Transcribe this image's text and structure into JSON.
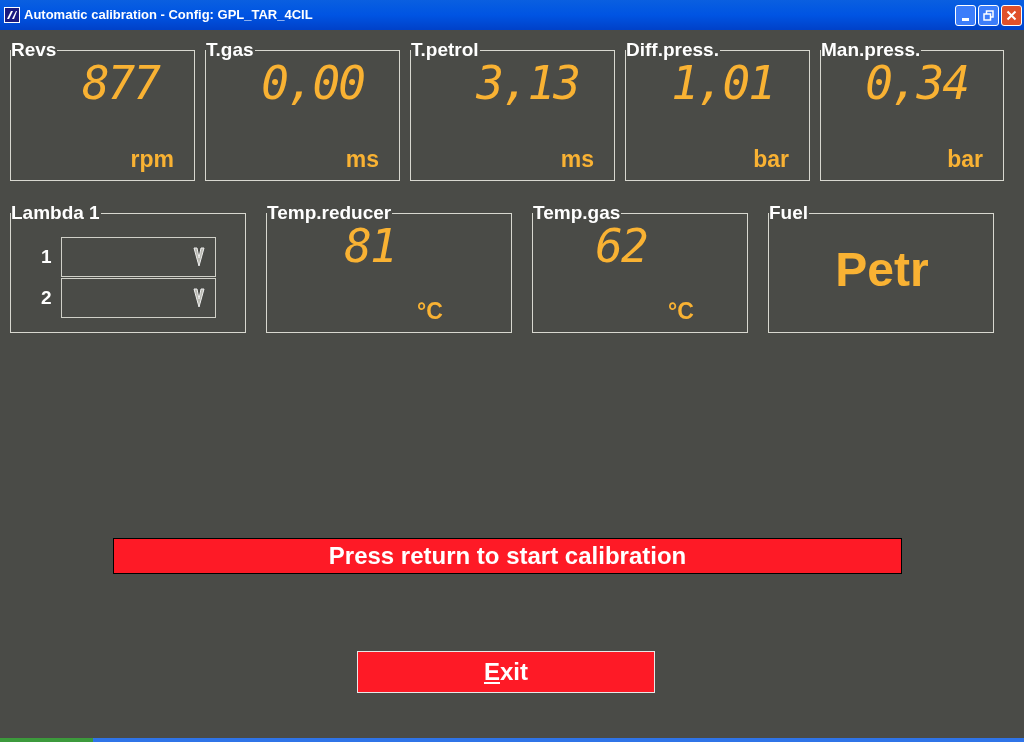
{
  "window": {
    "title": "Automatic calibration - Config: GPL_TAR_4CIL"
  },
  "gauges_top": [
    {
      "label": "Revs",
      "value": "877",
      "unit": "rpm"
    },
    {
      "label": "T.gas",
      "value": "0,00",
      "unit": "ms"
    },
    {
      "label": "T.petrol",
      "value": "3,13",
      "unit": "ms"
    },
    {
      "label": "Diff.press.",
      "value": "1,01",
      "unit": "bar"
    },
    {
      "label": "Man.press.",
      "value": "0,34",
      "unit": "bar"
    }
  ],
  "lambda": {
    "label": "Lambda 1",
    "rows": [
      {
        "label": "1"
      },
      {
        "label": "2"
      }
    ]
  },
  "gauges_bottom": [
    {
      "label": "Temp.reducer",
      "value": "81",
      "unit": "°C",
      "kind": "digital"
    },
    {
      "label": "Temp.gas",
      "value": "62",
      "unit": "°C",
      "kind": "digital"
    },
    {
      "label": "Fuel",
      "value": "Petr",
      "kind": "text"
    }
  ],
  "message": "Press return to start calibration",
  "exit_button": {
    "label": "Exit",
    "underline_first": true
  }
}
